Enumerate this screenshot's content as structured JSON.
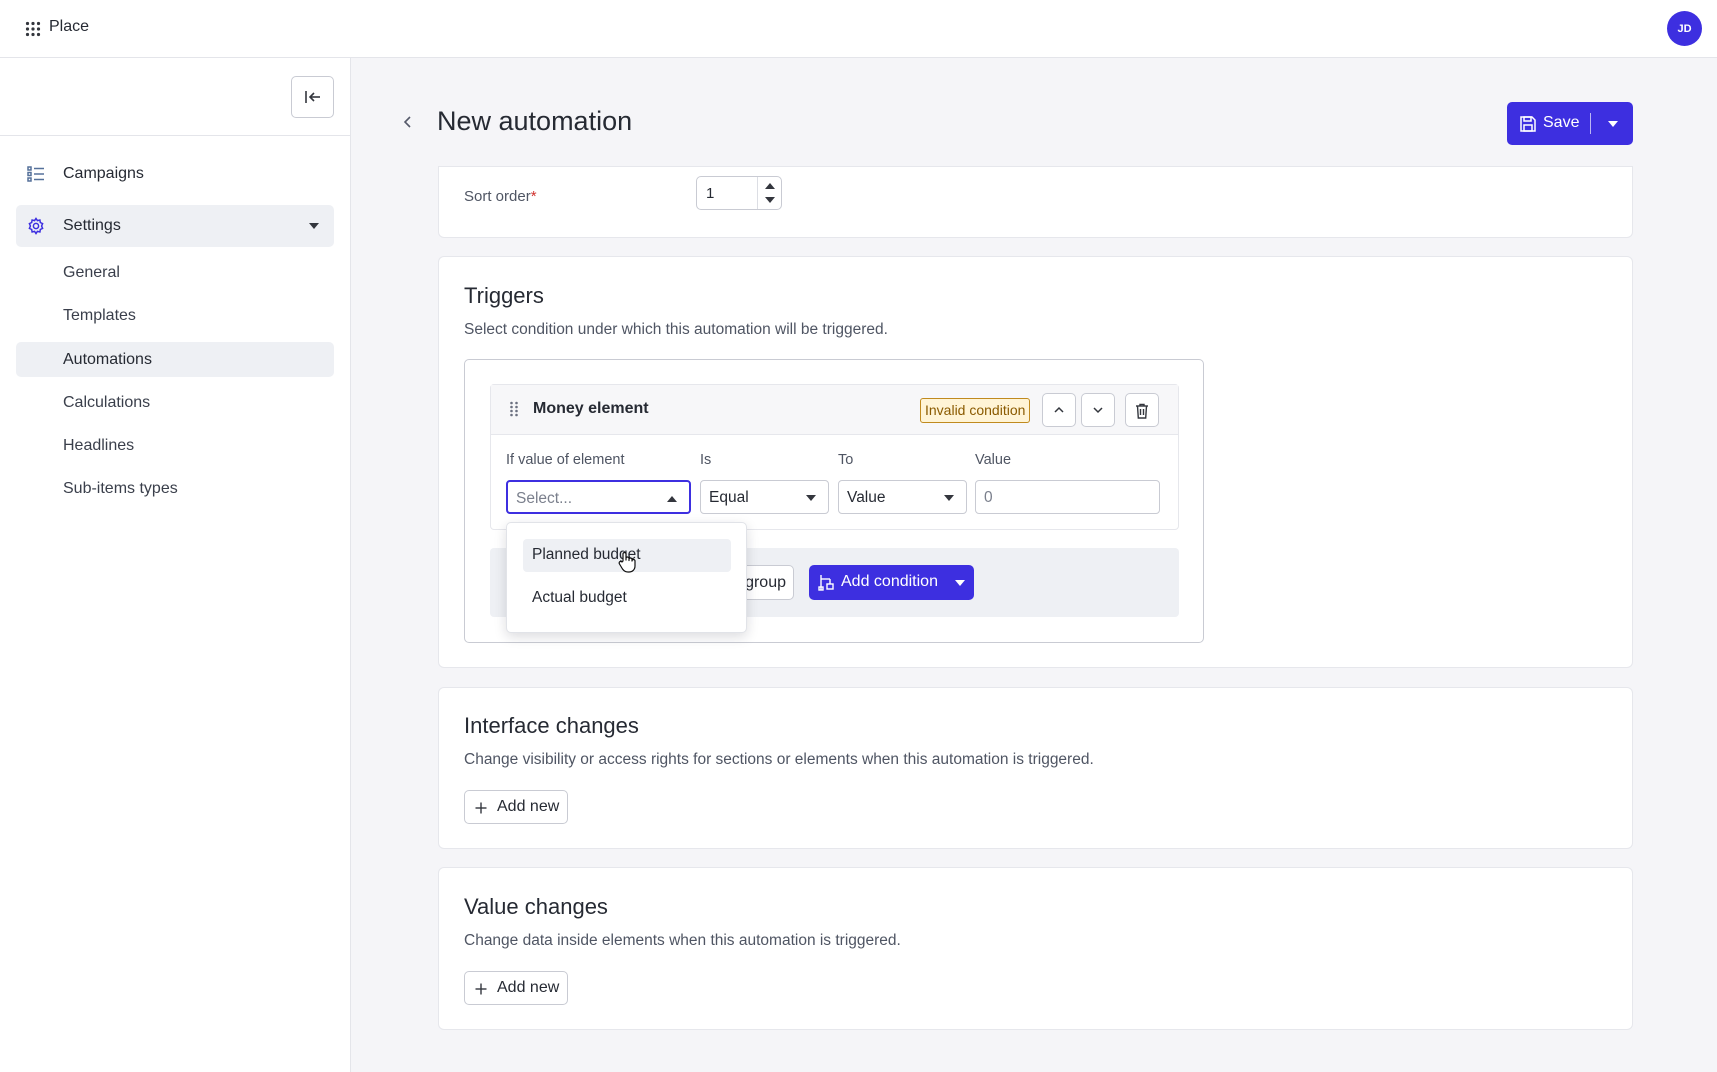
{
  "app": {
    "brand": "Place",
    "avatar_initials": "JD",
    "accent_color": "#3d2fe0"
  },
  "sidebar": {
    "collapse_icon": "collapse-left-icon",
    "items": [
      {
        "label": "Campaigns",
        "icon": "list-icon"
      },
      {
        "label": "Settings",
        "icon": "gear-icon",
        "expanded": true
      }
    ],
    "sub_items": [
      {
        "label": "General"
      },
      {
        "label": "Templates"
      },
      {
        "label": "Automations",
        "active": true
      },
      {
        "label": "Calculations"
      },
      {
        "label": "Headlines"
      },
      {
        "label": "Sub-items types"
      }
    ]
  },
  "header": {
    "title": "New automation",
    "save_label": "Save"
  },
  "general": {
    "sort_order_label": "Sort order",
    "required_mark": "*",
    "sort_order_value": "1"
  },
  "triggers": {
    "title": "Triggers",
    "description": "Select condition under which this automation will be triggered.",
    "condition": {
      "name": "Money element",
      "badge": "Invalid condition",
      "fields": {
        "element_label": "If value of element",
        "element_placeholder": "Select...",
        "is_label": "Is",
        "is_value": "Equal",
        "to_label": "To",
        "to_value": "Value",
        "value_label": "Value",
        "value_value": "0"
      }
    },
    "dropdown_options": [
      {
        "label": "Planned budget",
        "hovered": true
      },
      {
        "label": "Actual budget"
      }
    ],
    "group_button_visible_text": "l group",
    "add_condition_label": "Add condition"
  },
  "interface_changes": {
    "title": "Interface changes",
    "description": "Change visibility or access rights for sections or elements when this automation is triggered.",
    "add_label": "Add new"
  },
  "value_changes": {
    "title": "Value changes",
    "description": "Change data inside elements when this automation is triggered.",
    "add_label": "Add new"
  }
}
